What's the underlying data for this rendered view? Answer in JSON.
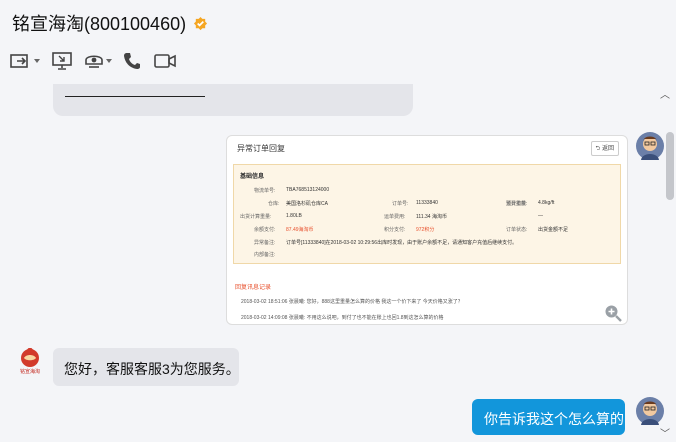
{
  "header": {
    "title": "铭宣海淘(800100460)",
    "verified_icon": "verified-badge-icon",
    "verified_color": "#f5a623",
    "tools": [
      "transfer-icon",
      "screen-share-icon",
      "service-icon",
      "phone-icon",
      "video-icon"
    ]
  },
  "messages": {
    "card": {
      "title": "异常订单回复",
      "back_label": "返回",
      "info_title": "基础信息",
      "rows": [
        {
          "l1": "物流单号:",
          "v1": "TBA768513124000",
          "l2": "",
          "v2": "",
          "l3": "",
          "v3": ""
        },
        {
          "l1": "仓库:",
          "v1": "美国洛杉矶仓库CA",
          "l2": "订单号:",
          "v2": "11333840",
          "l3": "预计重量:",
          "v3": "4.8kg/ft"
        },
        {
          "l1": "出货计算重量:",
          "v1": "1.80LB",
          "l2": "运单费用:",
          "v2": "111.34 海淘币",
          "l3": "运费扣款:",
          "v3": "—"
        },
        {
          "l1": "余额支付:",
          "v1": "87.49海淘币",
          "l2": "积分支付:",
          "v2": "972积分",
          "l3": "订单状态:",
          "v3": "出货金额不足"
        },
        {
          "l1": "异常备注:",
          "v1": "订单号[11333840]在2018-03-02 10:29:56出库时发现，由于账户余额不足，请通知客户充值后继续支付。",
          "l2": "",
          "v2": "",
          "l3": "",
          "v3": ""
        },
        {
          "l1": "内部备注:",
          "v1": "",
          "l2": "",
          "v2": "",
          "l3": "",
          "v3": ""
        }
      ],
      "log_title": "回复讯息记录",
      "log": [
        "2018-03-02 18:51:06 张晨曦: 您好，888这里重量怎么算的价格 我这一个价下来了 今天价格又涨了？",
        "2018-03-02 14:09:08 张晨曦: 不用这么说吧，到付了也不能在账上也回1.8到这怎么算的价格"
      ],
      "zoom_icon": "zoom-in-icon"
    },
    "agent": {
      "text": "您好，客服客服3为您服务。",
      "logo_text": "铭宣海淘"
    },
    "user": {
      "text": "你告诉我这个怎么算的"
    }
  },
  "colors": {
    "accent": "#1296db",
    "orange": "#e8502d",
    "bubble": "#e4e5ea"
  }
}
